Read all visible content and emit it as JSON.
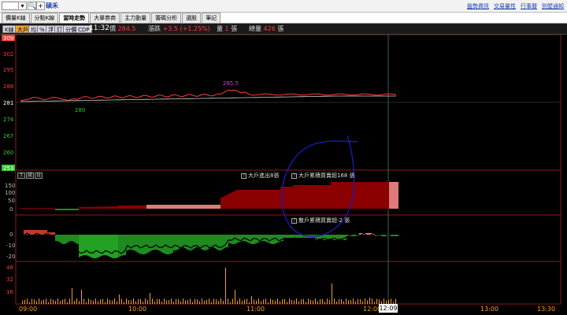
{
  "stock": {
    "input_value": "",
    "name": "碩禾",
    "dropdown_glyph": "▾",
    "search_glyph": "🔍",
    "add_glyph": "+"
  },
  "top_links": [
    "盤勢資訊",
    "交易量性",
    "行事曆",
    "別墅通知"
  ],
  "tabs": [
    {
      "label": "價量K線",
      "active": false
    },
    {
      "label": "分點K線",
      "active": false
    },
    {
      "label": "當時走勢",
      "active": true
    },
    {
      "label": "大單券商",
      "active": false
    },
    {
      "label": "主力動量",
      "active": false
    },
    {
      "label": "籌碼分析",
      "active": false
    },
    {
      "label": "選股",
      "active": false
    },
    {
      "label": "筆記",
      "active": false
    }
  ],
  "toolbar": {
    "buttons": [
      {
        "label": "K線",
        "on": false
      },
      {
        "label": "大戶",
        "on": true
      },
      {
        "label": "均",
        "on": false
      },
      {
        "label": "%",
        "on": false
      },
      {
        "label": "浮",
        "on": false
      },
      {
        "label": "訂",
        "on": false
      },
      {
        "label": "分價",
        "on": false
      },
      {
        "label": "CDP",
        "on": false
      }
    ],
    "time": "11:32",
    "price_label": "價",
    "price_value": "284.5",
    "change_label": "漲跌",
    "change_value": "+3.5 (+1.25%)",
    "volume_label": "量",
    "volume_value": "1",
    "volume_unit": "張",
    "total_label": "總量",
    "total_value": "426",
    "total_unit": "張"
  },
  "price_axis": {
    "top": "309",
    "ticks": [
      "302",
      "295",
      "288"
    ],
    "ref": "281",
    "low_ticks": [
      "274",
      "267",
      "260"
    ],
    "bottom": "253"
  },
  "price_annotations": {
    "high": "285.5",
    "low": "280"
  },
  "big_player_panel": {
    "axis_ticks": [
      "150",
      "100",
      "50",
      "0"
    ],
    "legend_a": "大戶進出8張",
    "legend_b": "大戶累積買賣超168 張",
    "small_buttons": [
      "↑",
      "設",
      "日"
    ]
  },
  "retail_panel": {
    "axis_ticks": [
      "0",
      "-10",
      "-20"
    ],
    "legend": "散戶累積買賣超-2 張"
  },
  "volume_panel": {
    "axis_ticks": [
      "48",
      "32",
      "16"
    ]
  },
  "x_axis": {
    "ticks": [
      "09:00",
      "10:00",
      "11:00",
      "12:00",
      "13:00",
      "13:30"
    ],
    "cursor_time": "12:09"
  },
  "colors": {
    "up": "#ff3b3b",
    "down": "#2ecc2e",
    "accent": "#f3a21f",
    "big_fill": "#8b0000",
    "retail_fill": "#1f8a1f",
    "annotation": "#1a1ab4"
  }
}
